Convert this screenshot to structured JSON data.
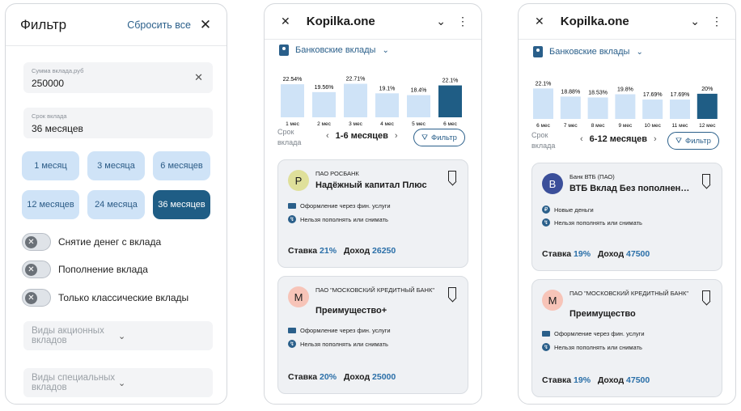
{
  "filter": {
    "title": "Фильтр",
    "reset_label": "Сбросить все",
    "amount_label": "Сумма вклада,руб",
    "amount_value": "250000",
    "term_label": "Срок вклада",
    "term_value": "36 месяцев",
    "chips": [
      "1 месяц",
      "3 месяца",
      "6 месяцев",
      "12 месяцев",
      "24 месяца",
      "36 месяцев"
    ],
    "selected_chip": "36 месяцев",
    "toggles": [
      "Снятие денег с вклада",
      "Пополнение вклада",
      "Только классические вклады"
    ],
    "dropdowns": [
      "Виды акционных вкладов",
      "Виды специальных вкладов"
    ]
  },
  "screen2": {
    "app_title": "Kopilka.one",
    "category": "Банковские вклады",
    "chart_data": {
      "type": "bar",
      "categories": [
        "1 мес",
        "2 мес",
        "3 мес",
        "4 мес",
        "5 мес",
        "6 мес"
      ],
      "values": [
        22.54,
        19.56,
        22.71,
        19.1,
        18.4,
        22.1
      ],
      "value_labels": [
        "22.54%",
        "19.56%",
        "22.71%",
        "19.1%",
        "18.4%",
        "22.1%"
      ],
      "selected_index": 5
    },
    "term_label_1": "Срок",
    "term_label_2": "вклада",
    "range_label": "1-6 месяцев",
    "filter_label": "Фильтр",
    "cards": [
      {
        "avatar": "Р",
        "avatar_color": "#dfe09a",
        "bank": "ПАО РОСБАНК",
        "name": "Надёжный капитал Плюс",
        "features": [
          "Оформление через фин. услуги",
          "Нельзя пополнять или снимать"
        ],
        "rate_label": "Ставка",
        "rate": "21%",
        "income_label": "Доход",
        "income": "26250"
      },
      {
        "avatar": "М",
        "avatar_color": "#f7c4b8",
        "bank": "ПАО \"МОСКОВСКИЙ КРЕДИТНЫЙ БАНК\"",
        "name": "Преимущество+",
        "features": [
          "Оформление через фин. услуги",
          "Нельзя пополнять или снимать"
        ],
        "rate_label": "Ставка",
        "rate": "20%",
        "income_label": "Доход",
        "income": "25000"
      }
    ]
  },
  "screen3": {
    "app_title": "Kopilka.one",
    "category": "Банковские вклады",
    "chart_data": {
      "type": "bar",
      "categories": [
        "6 мес",
        "7 мес",
        "8 мес",
        "9 мес",
        "10 мес",
        "11 мес",
        "12 мес"
      ],
      "values": [
        22.1,
        18.88,
        18.53,
        19.8,
        17.69,
        17.69,
        20
      ],
      "value_labels": [
        "22.1%",
        "18.88%",
        "18.53%",
        "19.8%",
        "17.69%",
        "17.69%",
        "20%"
      ],
      "selected_index": 6
    },
    "term_label_1": "Срок",
    "term_label_2": "вклада",
    "range_label": "6-12 месяцев",
    "filter_label": "Фильтр",
    "cards": [
      {
        "avatar": "В",
        "avatar_color": "#3b4f9a",
        "bank": "Банк ВТБ (ПАО)",
        "name": "ВТБ Вклад Без пополнения и снятия",
        "features": [
          "Новые деньги",
          "Нельзя пополнять или снимать"
        ],
        "rate_label": "Ставка",
        "rate": "19%",
        "income_label": "Доход",
        "income": "47500"
      },
      {
        "avatar": "М",
        "avatar_color": "#f7c4b8",
        "bank": "ПАО \"МОСКОВСКИЙ КРЕДИТНЫЙ БАНК\"",
        "name": "Преимущество",
        "features": [
          "Оформление через фин. услуги",
          "Нельзя пополнять или снимать"
        ],
        "rate_label": "Ставка",
        "rate": "19%",
        "income_label": "Доход",
        "income": "47500"
      }
    ]
  }
}
